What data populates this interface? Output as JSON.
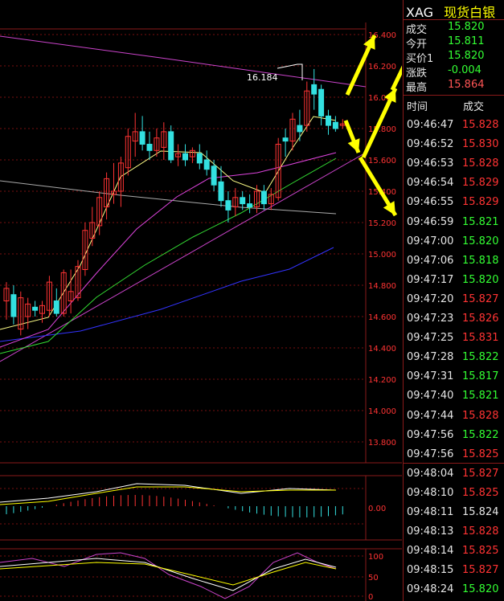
{
  "instrument": {
    "symbol": "XAG",
    "name": "现货白银"
  },
  "quote": [
    {
      "label": "成交",
      "value": "15.820",
      "color": "#33ff33"
    },
    {
      "label": "今开",
      "value": "15.811",
      "color": "#33ff33"
    },
    {
      "label": "买价1",
      "value": "15.820",
      "color": "#33ff33"
    },
    {
      "label": "涨跌",
      "value": "-0.004",
      "color": "#33ff33"
    },
    {
      "label": "最高",
      "value": "15.864",
      "color": "#ff5555"
    }
  ],
  "ticks_header": {
    "time": "时间",
    "price": "成交"
  },
  "ticks": [
    {
      "time": "09:46:47",
      "price": "15.828",
      "dir": "up"
    },
    {
      "time": "09:46:52",
      "price": "15.830",
      "dir": "up"
    },
    {
      "time": "09:46:53",
      "price": "15.828",
      "dir": "up"
    },
    {
      "time": "09:46:54",
      "price": "15.829",
      "dir": "up"
    },
    {
      "time": "09:46:55",
      "price": "15.829",
      "dir": "up"
    },
    {
      "time": "09:46:59",
      "price": "15.821",
      "dir": "down"
    },
    {
      "time": "09:47:00",
      "price": "15.820",
      "dir": "down"
    },
    {
      "time": "09:47:06",
      "price": "15.818",
      "dir": "down"
    },
    {
      "time": "09:47:17",
      "price": "15.820",
      "dir": "down"
    },
    {
      "time": "09:47:20",
      "price": "15.827",
      "dir": "up"
    },
    {
      "time": "09:47:23",
      "price": "15.826",
      "dir": "up"
    },
    {
      "time": "09:47:25",
      "price": "15.831",
      "dir": "up"
    },
    {
      "time": "09:47:28",
      "price": "15.822",
      "dir": "down"
    },
    {
      "time": "09:47:31",
      "price": "15.817",
      "dir": "down"
    },
    {
      "time": "09:47:40",
      "price": "15.821",
      "dir": "down"
    },
    {
      "time": "09:47:44",
      "price": "15.828",
      "dir": "up"
    },
    {
      "time": "09:47:56",
      "price": "15.822",
      "dir": "down"
    },
    {
      "time": "09:47:56",
      "price": "15.825",
      "dir": "up"
    },
    {
      "time": "09:48:04",
      "price": "15.827",
      "dir": "up"
    },
    {
      "time": "09:48:10",
      "price": "15.825",
      "dir": "up"
    },
    {
      "time": "09:48:11",
      "price": "15.824",
      "dir": "flat"
    },
    {
      "time": "09:48:13",
      "price": "15.828",
      "dir": "up"
    },
    {
      "time": "09:48:14",
      "price": "15.825",
      "dir": "up"
    },
    {
      "time": "09:48:15",
      "price": "15.827",
      "dir": "up"
    },
    {
      "time": "09:48:24",
      "price": "15.820",
      "dir": "down"
    }
  ],
  "colors": {
    "up": "#ff3333",
    "down": "#33ff33",
    "flat": "#e6e6e6",
    "grid": "#7a1010",
    "axis_text": "#ff3333"
  },
  "chart_data": {
    "type": "candlestick",
    "ylim": [
      13.7,
      16.5
    ],
    "yticks": [
      "16.400",
      "16.200",
      "16.000",
      "15.800",
      "15.600",
      "15.400",
      "15.200",
      "15.000",
      "14.800",
      "14.600",
      "14.400",
      "14.200",
      "14.000",
      "13.800"
    ],
    "annotation": "16.184",
    "candles": [
      {
        "o": 14.7,
        "h": 14.82,
        "l": 14.58,
        "c": 14.78
      },
      {
        "o": 14.74,
        "h": 14.8,
        "l": 14.55,
        "c": 14.6
      },
      {
        "o": 14.52,
        "h": 14.76,
        "l": 14.48,
        "c": 14.72
      },
      {
        "o": 14.6,
        "h": 14.72,
        "l": 14.52,
        "c": 14.68
      },
      {
        "o": 14.66,
        "h": 14.7,
        "l": 14.6,
        "c": 14.64
      },
      {
        "o": 14.62,
        "h": 14.7,
        "l": 14.56,
        "c": 14.67
      },
      {
        "o": 14.64,
        "h": 14.86,
        "l": 14.6,
        "c": 14.82
      },
      {
        "o": 14.7,
        "h": 14.78,
        "l": 14.6,
        "c": 14.62
      },
      {
        "o": 14.62,
        "h": 14.9,
        "l": 14.6,
        "c": 14.88
      },
      {
        "o": 14.7,
        "h": 14.9,
        "l": 14.62,
        "c": 14.76
      },
      {
        "o": 14.72,
        "h": 14.96,
        "l": 14.7,
        "c": 14.92
      },
      {
        "o": 14.9,
        "h": 15.2,
        "l": 14.86,
        "c": 15.15
      },
      {
        "o": 15.1,
        "h": 15.3,
        "l": 15.05,
        "c": 15.2
      },
      {
        "o": 15.18,
        "h": 15.4,
        "l": 15.12,
        "c": 15.36
      },
      {
        "o": 15.3,
        "h": 15.52,
        "l": 15.22,
        "c": 15.48
      },
      {
        "o": 15.38,
        "h": 15.58,
        "l": 15.32,
        "c": 15.4
      },
      {
        "o": 15.4,
        "h": 15.62,
        "l": 15.3,
        "c": 15.58
      },
      {
        "o": 15.55,
        "h": 15.8,
        "l": 15.5,
        "c": 15.75
      },
      {
        "o": 15.72,
        "h": 15.9,
        "l": 15.62,
        "c": 15.78
      },
      {
        "o": 15.78,
        "h": 15.88,
        "l": 15.66,
        "c": 15.7
      },
      {
        "o": 15.7,
        "h": 15.78,
        "l": 15.6,
        "c": 15.66
      },
      {
        "o": 15.66,
        "h": 15.8,
        "l": 15.62,
        "c": 15.74
      },
      {
        "o": 15.68,
        "h": 15.84,
        "l": 15.6,
        "c": 15.78
      },
      {
        "o": 15.78,
        "h": 15.82,
        "l": 15.58,
        "c": 15.6
      },
      {
        "o": 15.62,
        "h": 15.7,
        "l": 15.56,
        "c": 15.64
      },
      {
        "o": 15.64,
        "h": 15.7,
        "l": 15.56,
        "c": 15.6
      },
      {
        "o": 15.62,
        "h": 15.68,
        "l": 15.58,
        "c": 15.66
      },
      {
        "o": 15.64,
        "h": 15.7,
        "l": 15.54,
        "c": 15.58
      },
      {
        "o": 15.6,
        "h": 15.66,
        "l": 15.5,
        "c": 15.54
      },
      {
        "o": 15.56,
        "h": 15.6,
        "l": 15.4,
        "c": 15.44
      },
      {
        "o": 15.46,
        "h": 15.56,
        "l": 15.3,
        "c": 15.34
      },
      {
        "o": 15.34,
        "h": 15.4,
        "l": 15.2,
        "c": 15.28
      },
      {
        "o": 15.3,
        "h": 15.42,
        "l": 15.24,
        "c": 15.36
      },
      {
        "o": 15.36,
        "h": 15.4,
        "l": 15.28,
        "c": 15.32
      },
      {
        "o": 15.32,
        "h": 15.38,
        "l": 15.26,
        "c": 15.3
      },
      {
        "o": 15.3,
        "h": 15.44,
        "l": 15.26,
        "c": 15.4
      },
      {
        "o": 15.4,
        "h": 15.44,
        "l": 15.28,
        "c": 15.32
      },
      {
        "o": 15.32,
        "h": 15.42,
        "l": 15.28,
        "c": 15.38
      },
      {
        "o": 15.36,
        "h": 15.74,
        "l": 15.34,
        "c": 15.7
      },
      {
        "o": 15.74,
        "h": 15.8,
        "l": 15.62,
        "c": 15.72
      },
      {
        "o": 15.72,
        "h": 15.9,
        "l": 15.66,
        "c": 15.86
      },
      {
        "o": 15.82,
        "h": 15.92,
        "l": 15.72,
        "c": 15.78
      },
      {
        "o": 15.82,
        "h": 16.1,
        "l": 15.78,
        "c": 16.04
      },
      {
        "o": 16.08,
        "h": 16.18,
        "l": 15.92,
        "c": 16.02
      },
      {
        "o": 16.05,
        "h": 16.08,
        "l": 15.82,
        "c": 15.88
      },
      {
        "o": 15.88,
        "h": 15.92,
        "l": 15.76,
        "c": 15.82
      },
      {
        "o": 15.84,
        "h": 15.88,
        "l": 15.78,
        "c": 15.8
      },
      {
        "o": 15.82,
        "h": 15.86,
        "l": 15.8,
        "c": 15.83
      }
    ]
  }
}
